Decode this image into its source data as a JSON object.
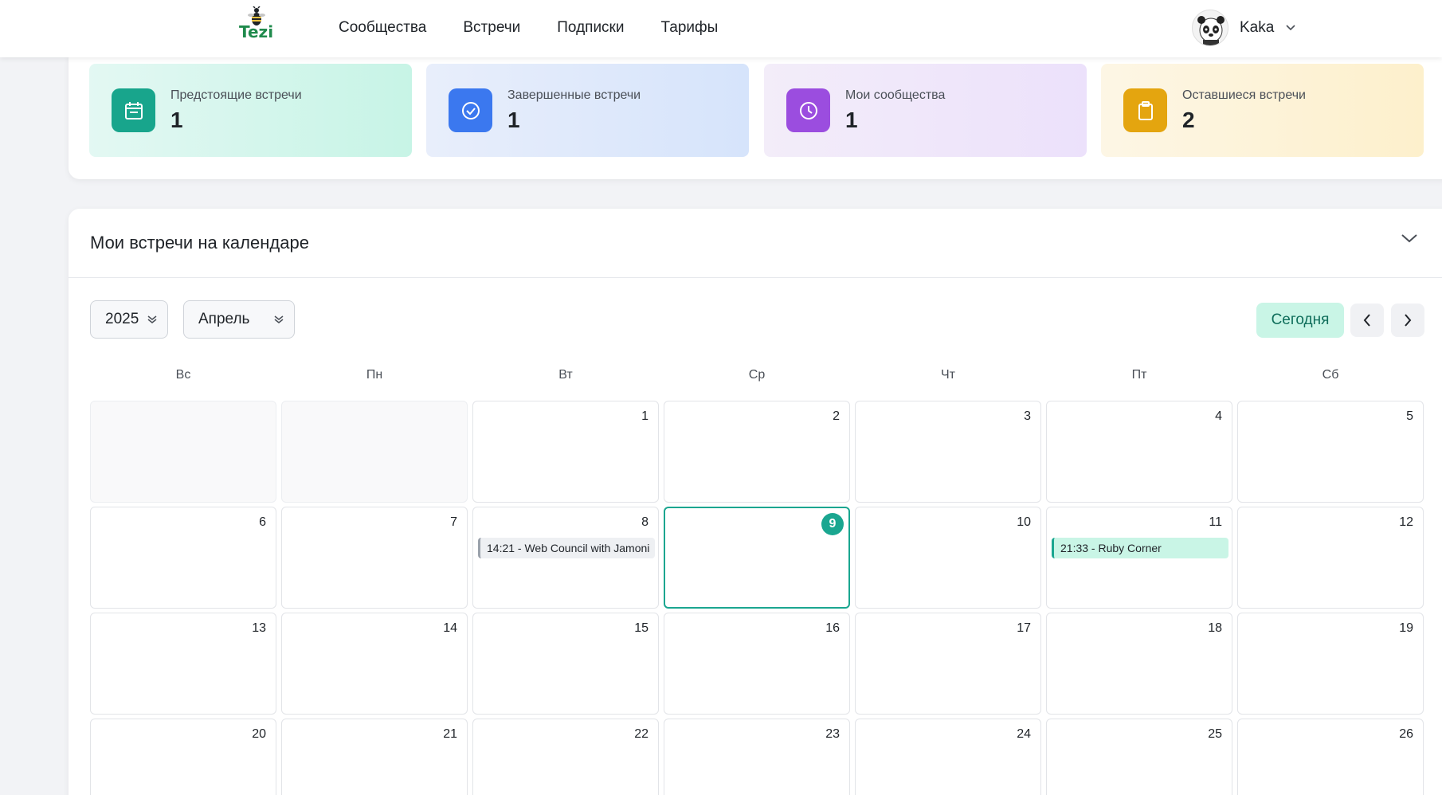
{
  "header": {
    "logo_text": "Tezi",
    "nav": [
      "Сообщества",
      "Встречи",
      "Подписки",
      "Тарифы"
    ],
    "user_name": "Kaka"
  },
  "stats": [
    {
      "label": "Предстоящие встречи",
      "value": "1",
      "icon": "calendar-icon",
      "color": "#18a58c"
    },
    {
      "label": "Завершенные встречи",
      "value": "1",
      "icon": "check-circle-icon",
      "color": "#3b78ef"
    },
    {
      "label": "Мои сообщества",
      "value": "1",
      "icon": "clock-icon",
      "color": "#9b4ddf"
    },
    {
      "label": "Оставшиеся встречи",
      "value": "2",
      "icon": "clipboard-icon",
      "color": "#e4a50f"
    }
  ],
  "calendar": {
    "title": "Мои встречи на календаре",
    "year": "2025",
    "month": "Апрель",
    "today_label": "Сегодня",
    "weekdays": [
      "Вс",
      "Пн",
      "Вт",
      "Ср",
      "Чт",
      "Пт",
      "Сб"
    ],
    "today_day": 9,
    "days": [
      "",
      "",
      "1",
      "2",
      "3",
      "4",
      "5",
      "6",
      "7",
      "8",
      "9",
      "10",
      "11",
      "12",
      "13",
      "14",
      "15",
      "16",
      "17",
      "18",
      "19",
      "20",
      "21",
      "22",
      "23",
      "24",
      "25",
      "26"
    ],
    "events": [
      {
        "day": "8",
        "text": "14:21 - Web Council with Jamoni",
        "style": "gray"
      },
      {
        "day": "11",
        "text": "21:33 - Ruby Corner",
        "style": "green"
      }
    ]
  }
}
